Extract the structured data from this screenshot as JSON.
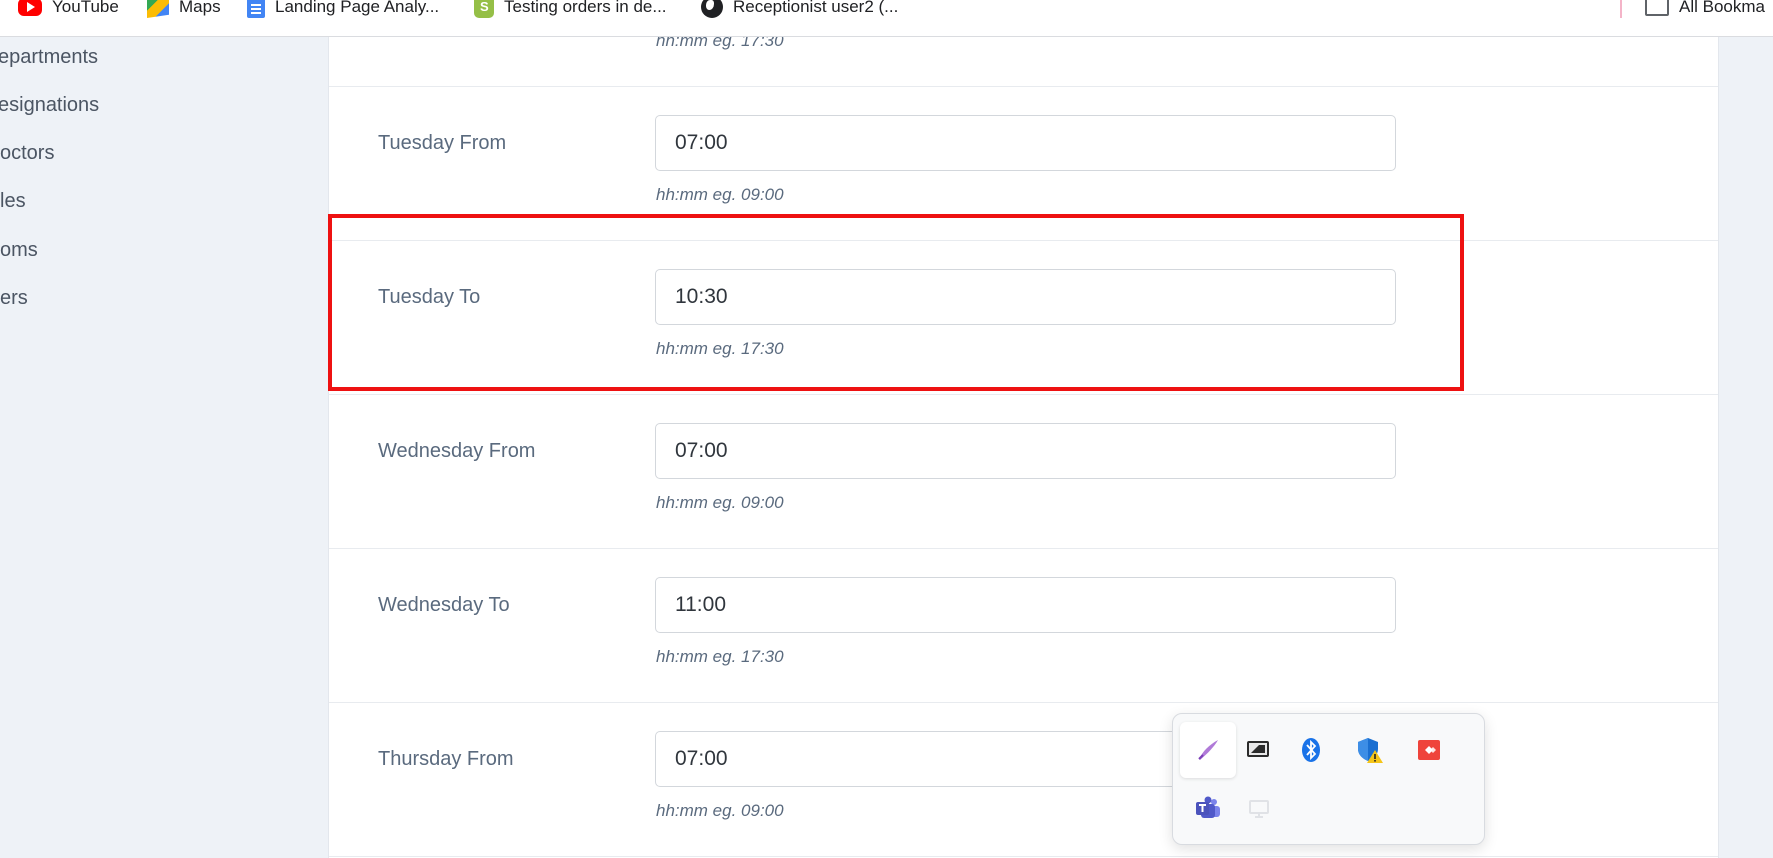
{
  "bookmarks": {
    "items": [
      {
        "label": "YouTube",
        "icon": "youtube-icon"
      },
      {
        "label": "Maps",
        "icon": "maps-icon"
      },
      {
        "label": "Landing Page Analy...",
        "icon": "docs-icon"
      },
      {
        "label": "Testing orders in de...",
        "icon": "shopify-icon"
      },
      {
        "label": "Receptionist user2 (...",
        "icon": "globe-icon"
      }
    ],
    "all_bookmarks": "All Bookma"
  },
  "sidebar": {
    "items": [
      "epartments",
      "esignations",
      "octors",
      "les",
      "oms",
      "ers"
    ]
  },
  "form": {
    "top_hint": "hh:mm eg. 17:30",
    "fields": [
      {
        "label": "Tuesday From",
        "value": "07:00",
        "hint": "hh:mm eg. 09:00"
      },
      {
        "label": "Tuesday To",
        "value": "10:30",
        "hint": "hh:mm eg. 17:30"
      },
      {
        "label": "Wednesday From",
        "value": "07:00",
        "hint": "hh:mm eg. 09:00"
      },
      {
        "label": "Wednesday To",
        "value": "11:00",
        "hint": "hh:mm eg. 17:30"
      },
      {
        "label": "Thursday From",
        "value": "07:00",
        "hint": "hh:mm eg. 09:00"
      }
    ]
  },
  "tray": {
    "icons": [
      "pen-icon",
      "display-icon",
      "bluetooth-icon",
      "security-warning-icon",
      "anydesk-icon",
      "teams-icon",
      "network-icon"
    ]
  },
  "colors": {
    "highlight": "#ee1111",
    "label": "#5a6a7e",
    "page_bg": "#eef2f7"
  }
}
